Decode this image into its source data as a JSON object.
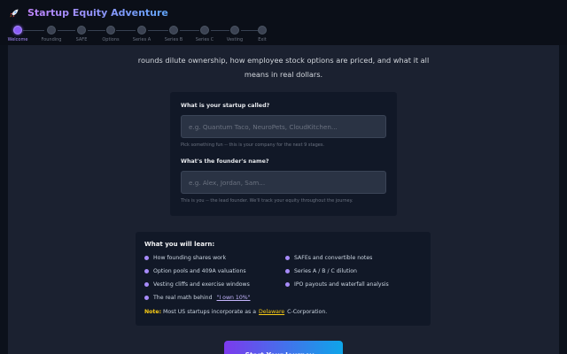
{
  "header": {
    "title": "Startup Equity Adventure",
    "logo_icon": "rocket-icon",
    "accent_colors": [
      "#c084fc",
      "#60a5fa"
    ]
  },
  "stepper": {
    "steps": [
      {
        "label": "Welcome",
        "active": true
      },
      {
        "label": "Founding",
        "active": false
      },
      {
        "label": "SAFE",
        "active": false
      },
      {
        "label": "Options",
        "active": false
      },
      {
        "label": "Series A",
        "active": false
      },
      {
        "label": "Series B",
        "active": false
      },
      {
        "label": "Series C",
        "active": false
      },
      {
        "label": "Vesting",
        "active": false
      },
      {
        "label": "Exit",
        "active": false
      }
    ],
    "active_color": "#8b5cf6"
  },
  "intro": {
    "line1": "rounds dilute ownership, how employee stock options are priced, and what it all",
    "line2": "means in real dollars."
  },
  "form": {
    "startup": {
      "label": "What is your startup called?",
      "placeholder": "e.g. Quantum Taco, NeuroPets, CloudKitchen...",
      "hint": "Pick something fun -- this is your company for the next 9 stages."
    },
    "founder": {
      "label": "What's the founder's name?",
      "placeholder": "e.g. Alex, Jordan, Sam...",
      "hint": "This is you -- the lead founder. We'll track your equity throughout the journey."
    }
  },
  "learn": {
    "title": "What you will learn:",
    "items": [
      "How founding shares work",
      "SAFEs and convertible notes",
      "Option pools and 409A valuations",
      "Series A / B / C dilution",
      "Vesting cliffs and exercise windows",
      "IPO payouts and waterfall analysis",
      "The real math behind"
    ],
    "link": "\"I own 10%\"",
    "note_label": "Note:",
    "note_text": "Most US startups incorporate as a",
    "note_link": "Delaware",
    "note_end": "C-Corporation."
  },
  "cta": {
    "label": "Start Your Journey →"
  }
}
